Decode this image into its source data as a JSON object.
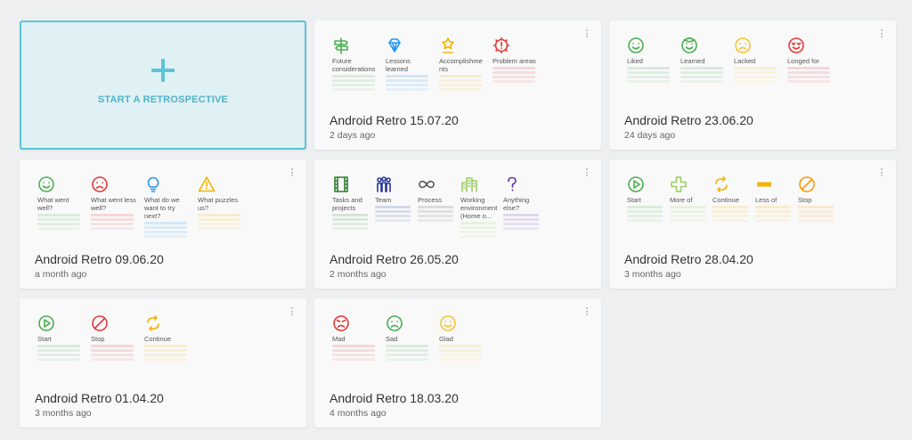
{
  "start": {
    "label": "START A RETROSPECTIVE"
  },
  "cards": [
    {
      "title": "Android Retro 15.07.20",
      "ago": "2 days ago",
      "columns": [
        {
          "label": "Future considerations",
          "icon": "signpost-icon",
          "color": "#4caf50"
        },
        {
          "label": "Lessons learned",
          "icon": "diamond-icon",
          "color": "#2196f3"
        },
        {
          "label": "Accomplishments",
          "icon": "award-icon",
          "color": "#f4b400"
        },
        {
          "label": "Problem areas",
          "icon": "alert-gear-icon",
          "color": "#e53935"
        }
      ]
    },
    {
      "title": "Android Retro 23.06.20",
      "ago": "24 days ago",
      "columns": [
        {
          "label": "Liked",
          "icon": "smile-icon",
          "color": "#4caf50"
        },
        {
          "label": "Learned",
          "icon": "learned-face-icon",
          "color": "#4caf50"
        },
        {
          "label": "Lacked",
          "icon": "frown-icon",
          "color": "#f4c430"
        },
        {
          "label": "Longed for",
          "icon": "love-face-icon",
          "color": "#e53935"
        }
      ]
    },
    {
      "title": "Android Retro 09.06.20",
      "ago": "a month ago",
      "columns": [
        {
          "label": "What went well?",
          "icon": "smile-icon",
          "color": "#4caf50"
        },
        {
          "label": "What went less well?",
          "icon": "frown-icon",
          "color": "#e53935"
        },
        {
          "label": "What do we want to try next?",
          "icon": "bulb-icon",
          "color": "#2196f3"
        },
        {
          "label": "What puzzles us?",
          "icon": "warning-icon",
          "color": "#f4b400"
        }
      ]
    },
    {
      "title": "Android Retro 26.05.20",
      "ago": "2 months ago",
      "columns": [
        {
          "label": "Tasks and projects",
          "icon": "film-icon",
          "color": "#2e7d32"
        },
        {
          "label": "Team",
          "icon": "team-icon",
          "color": "#283593"
        },
        {
          "label": "Process",
          "icon": "infinity-icon",
          "color": "#555555"
        },
        {
          "label": "Working environment (Home o...",
          "icon": "building-icon",
          "color": "#9ccc65"
        },
        {
          "label": "Anything else?",
          "icon": "question-icon",
          "color": "#5e35b1"
        }
      ]
    },
    {
      "title": "Android Retro 28.04.20",
      "ago": "3 months ago",
      "columns": [
        {
          "label": "Start",
          "icon": "play-icon",
          "color": "#4caf50"
        },
        {
          "label": "More of",
          "icon": "plus-icon",
          "color": "#9ccc65"
        },
        {
          "label": "Continue",
          "icon": "cycle-icon",
          "color": "#f4b400"
        },
        {
          "label": "Less of",
          "icon": "minus-icon",
          "color": "#f4b400"
        },
        {
          "label": "Stop",
          "icon": "stop-icon",
          "color": "#ff9800"
        }
      ]
    },
    {
      "title": "Android Retro 01.04.20",
      "ago": "3 months ago",
      "columns": [
        {
          "label": "Start",
          "icon": "play-icon",
          "color": "#4caf50"
        },
        {
          "label": "Stop",
          "icon": "stop-icon",
          "color": "#e53935"
        },
        {
          "label": "Continue",
          "icon": "cycle-icon",
          "color": "#f4b400"
        }
      ]
    },
    {
      "title": "Android Retro 18.03.20",
      "ago": "4 months ago",
      "columns": [
        {
          "label": "Mad",
          "icon": "mad-icon",
          "color": "#e53935"
        },
        {
          "label": "Sad",
          "icon": "frown-icon",
          "color": "#4caf50"
        },
        {
          "label": "Glad",
          "icon": "smile-icon",
          "color": "#f4c430"
        }
      ]
    }
  ]
}
